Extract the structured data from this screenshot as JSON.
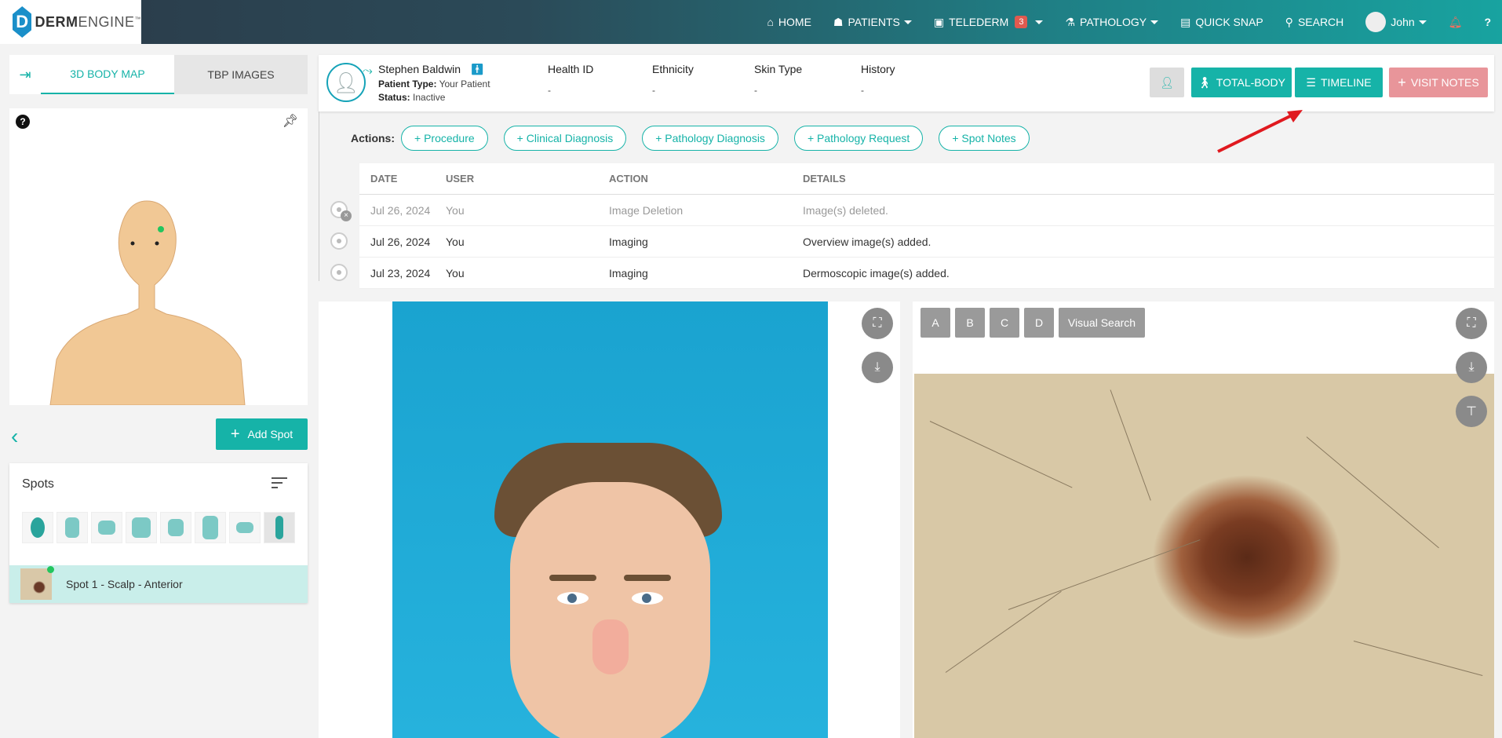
{
  "app": {
    "logo_letter": "D",
    "logo_bold": "DERM",
    "logo_rest": "ENGINE",
    "logo_tm": "™"
  },
  "nav": {
    "home": "HOME",
    "patients": "PATIENTS",
    "telederm": "TELEDERM",
    "telederm_badge": "3",
    "pathology": "PATHOLOGY",
    "quick_snap": "QUICK SNAP",
    "search": "SEARCH",
    "user": "John"
  },
  "left": {
    "tab_body_map": "3D BODY MAP",
    "tab_tbp": "TBP IMAGES",
    "add_spot": "Add Spot",
    "spots_title": "Spots",
    "spot_label": "Spot 1 - Scalp - Anterior",
    "help": "?"
  },
  "patient": {
    "name": "Stephen Baldwin",
    "type_label": "Patient Type:",
    "type_value": "Your Patient",
    "status_label": "Status:",
    "status_value": "Inactive",
    "health_id_label": "Health ID",
    "health_id_value": "-",
    "ethnicity_label": "Ethnicity",
    "ethnicity_value": "-",
    "skin_type_label": "Skin Type",
    "skin_type_value": "-",
    "history_label": "History",
    "history_value": "-"
  },
  "header_buttons": {
    "total_body": "TOTAL-BODY",
    "timeline": "TIMELINE",
    "visit_notes": "VISIT NOTES"
  },
  "actions": {
    "label": "Actions:",
    "items": [
      "+ Procedure",
      "+ Clinical Diagnosis",
      "+ Pathology Diagnosis",
      "+ Pathology Request",
      "+ Spot Notes"
    ]
  },
  "timeline": {
    "headers": [
      "DATE",
      "USER",
      "ACTION",
      "DETAILS"
    ],
    "rows": [
      [
        "Jul 26, 2024",
        "You",
        "Image Deletion",
        "Image(s) deleted."
      ],
      [
        "Jul 26, 2024",
        "You",
        "Imaging",
        "Overview image(s) added."
      ],
      [
        "Jul 23, 2024",
        "You",
        "Imaging",
        "Dermoscopic image(s) added."
      ]
    ]
  },
  "viewer": {
    "btn_a": "A",
    "btn_b": "B",
    "btn_c": "C",
    "btn_d": "D",
    "visual_search": "Visual Search"
  },
  "colors": {
    "accent": "#16b3a8",
    "visit_notes": "#e8959a",
    "badge": "#e05a4f"
  }
}
